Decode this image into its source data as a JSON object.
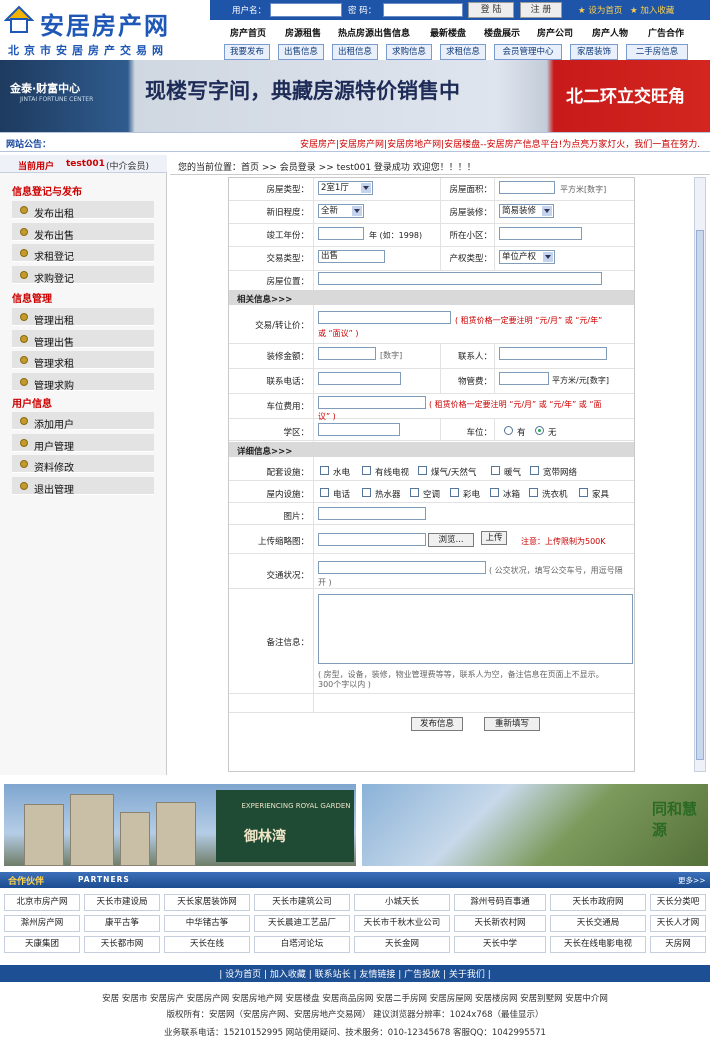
{
  "site": {
    "title": "安居房产网",
    "subtitle": "北京市安居房产交易网"
  },
  "login": {
    "user_label": "用户名：",
    "pwd_label": "密  码：",
    "login_btn": "登 陆",
    "register_btn": "注 册",
    "set_home": "设为首页",
    "add_fav": "加入收藏"
  },
  "nav_main": [
    "房产首页",
    "房源租售",
    "热点房源出售信息",
    "最新楼盘",
    "楼盘展示",
    "房产公司",
    "房产人物",
    "广告合作"
  ],
  "nav_sub": [
    "我要发布",
    "出售信息",
    "出租信息",
    "求购信息",
    "求租信息",
    "会员管理中心",
    "家居装饰",
    "二手房信息"
  ],
  "banner": {
    "brand": "金泰·财富中心",
    "brand_en": "JINTAI FORTUNE CENTER",
    "slogan": "现楼写字间，典藏房源特价销售中",
    "right": "北二环立交旺角"
  },
  "notice": {
    "label": "网站公告：",
    "text": "安居房产|安居房产网|安居房地产网|安居楼盘--安居房产信息平台!为点亮万家灯火，我们一直在努力..."
  },
  "sidebar": {
    "current_user_label": "当前用户",
    "username": "test001",
    "role": "(中介会员)",
    "sections": [
      {
        "title": "信息登记与发布",
        "items": [
          "发布出租",
          "发布出售",
          "求租登记",
          "求购登记"
        ]
      },
      {
        "title": "信息管理",
        "items": [
          "管理出租",
          "管理出售",
          "管理求租",
          "管理求购"
        ]
      },
      {
        "title": "用户信息",
        "items": [
          "添加用户",
          "用户管理",
          "资料修改",
          "退出管理"
        ]
      }
    ]
  },
  "breadcrumb": "您的当前位置：首页 >> 会员登录 >> test001 登录成功 欢迎您！！！！",
  "form": {
    "house_type_label": "房屋类型：",
    "house_type_value": "2室1厅",
    "area_label": "房屋面积：",
    "area_unit": "平方米[数字]",
    "newness_label": "新旧程度：",
    "newness_value": "全新",
    "decor_label": "房屋装修：",
    "decor_value": "简易装修",
    "year_label": "竣工年份：",
    "year_hint": "年 (如：1998)",
    "community_label": "所在小区：",
    "trade_label": "交易类型：",
    "trade_value": "出售",
    "property_label": "产权类型：",
    "property_value": "单位产权",
    "location_label": "房屋位置：",
    "section_related": "相关信息>>>",
    "price_label": "交易/转让价：",
    "price_warn": "( 租赁价格一定要注明 “元/月” 或 “元/年”",
    "price_warn2": "或 “面议” )",
    "decor_amount_label": "装修金额：",
    "decor_amount_hint": "[数字]",
    "contact_label": "联系人：",
    "phone_label": "联系电话：",
    "mgmt_fee_label": "物管费：",
    "mgmt_fee_unit": "平方米/元[数字]",
    "parking_fee_label": "车位费用：",
    "parking_warn": "( 租赁价格一定要注明 “元/月” 或 “元/年” 或 “面",
    "parking_warn2": "议” )",
    "school_label": "学区：",
    "parking_label": "车位：",
    "parking_yes": "有",
    "parking_no": "无",
    "section_detail": "详细信息>>>",
    "facilities_label": "配套设施：",
    "facilities": [
      "水电",
      "有线电视",
      "煤气/天然气",
      "暖气",
      "宽带网络"
    ],
    "indoor_label": "屋内设施：",
    "indoor": [
      "电话",
      "热水器",
      "空调",
      "彩电",
      "冰箱",
      "洗衣机",
      "家具"
    ],
    "image_label": "图片：",
    "thumb_label": "上传缩略图：",
    "browse_btn": "浏览...",
    "upload_btn": "上传",
    "upload_warn": "注意：上传限制为500K",
    "traffic_label": "交通状况：",
    "traffic_hint": "( 公交状况，填写公交车号，用逗号隔",
    "traffic_hint2": "开 )",
    "remark_label": "备注信息：",
    "remark_hint": "( 房型，设备，装修，物业管理费等等，联系人为空，备注信息在页面上不显示。",
    "remark_hint2": "300个字以内 )",
    "submit_btn": "发布信息",
    "reset_btn": "重新填写"
  },
  "ads": {
    "ad1_en": "EXPERIENCING ROYAL GARDEN",
    "ad1_cn": "御林湾",
    "ad2_cn": "同和慧源"
  },
  "partners": {
    "title": "合作伙伴",
    "title_en": "PARTNERS",
    "more": "更多>>",
    "rows": [
      [
        "北京市房产网",
        "天长市建设局",
        "天长家居装饰网",
        "天长市建筑公司",
        "小城天长",
        "滁州号码百事通",
        "天长市政府网",
        "天长分类吧"
      ],
      [
        "滁州房产网",
        "康平古筝",
        "中华锗古筝",
        "天长晨迪工艺品厂",
        "天长市千秋木业公司",
        "天长新农村网",
        "天长交通局",
        "天长人才网"
      ],
      [
        "天康集团",
        "天长都市网",
        "天长在线",
        "白塔河论坛",
        "天长金网",
        "天长中学",
        "天长在线电影电视",
        "天房网"
      ]
    ]
  },
  "footer": {
    "links": "| 设为首页 | 加入收藏 | 联系站长 | 友情链接 | 广告投放 | 关于我们 |",
    "keywords": "安居 安居市 安居房产 安居房产网 安居房地产网 安居楼盘 安居商品房网 安居二手房网 安居房屋网 安居楼房网 安居别墅网 安居中介网",
    "copyright": "版权所有：安居网（安居房产网、安居房地产交易网）    建议浏览器分辨率：1024x768（最佳显示）",
    "contact": "业务联系电话：15210152995    网站使用疑问、技术服务：010-12345678    客服QQ：1042995571"
  }
}
